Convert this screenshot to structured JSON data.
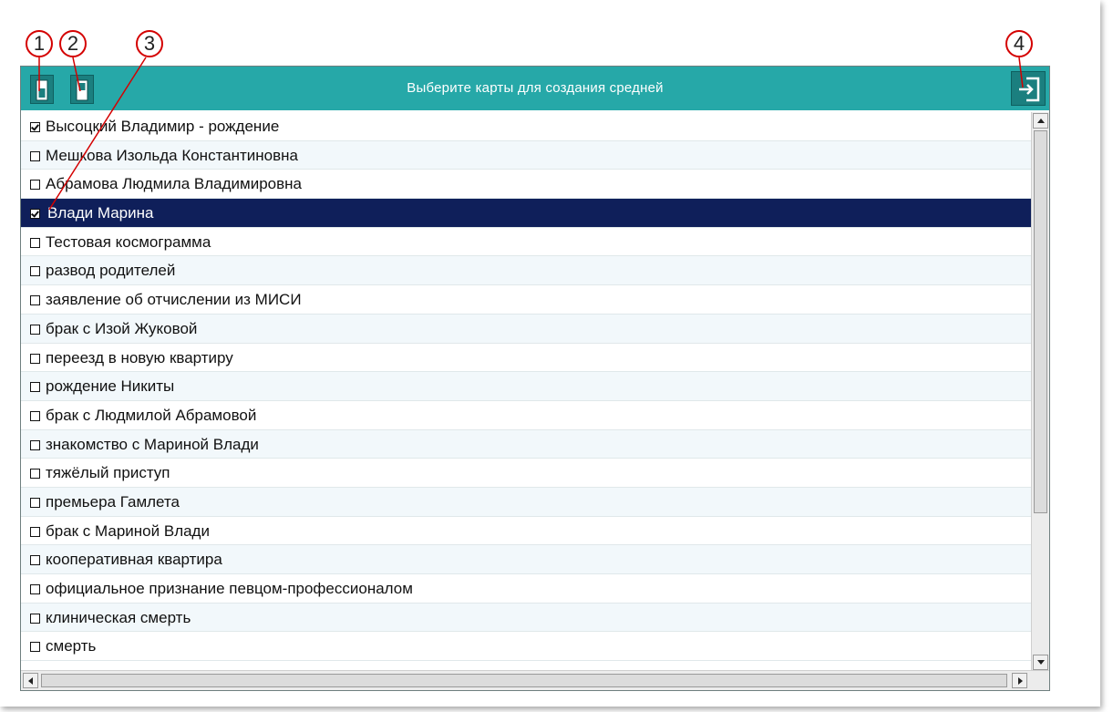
{
  "header": {
    "title": "Выберите карты для создания средней"
  },
  "toolbar": {
    "left_button_1_icon": "select-all-icon",
    "left_button_2_icon": "deselect-all-icon",
    "exit_button_icon": "exit-icon"
  },
  "callouts": [
    "1",
    "2",
    "3",
    "4"
  ],
  "colors": {
    "titlebar": "#26a8a8",
    "selected_row": "#0f1f5a",
    "callout_border": "#d40000"
  },
  "list": {
    "items": [
      {
        "label": "Высоцкий Владимир - рождение",
        "checked": true,
        "selected": false
      },
      {
        "label": "Мешкова Изольда Константиновна",
        "checked": false,
        "selected": false
      },
      {
        "label": "Абрамова Людмила Владимировна",
        "checked": false,
        "selected": false
      },
      {
        "label": "Влади Марина",
        "checked": true,
        "selected": true
      },
      {
        "label": "Тестовая космограмма",
        "checked": false,
        "selected": false
      },
      {
        "label": "развод родителей",
        "checked": false,
        "selected": false
      },
      {
        "label": "заявление об отчислении из МИСИ",
        "checked": false,
        "selected": false
      },
      {
        "label": "брак с Изой Жуковой",
        "checked": false,
        "selected": false
      },
      {
        "label": "переезд в новую квартиру",
        "checked": false,
        "selected": false
      },
      {
        "label": "рождение Никиты",
        "checked": false,
        "selected": false
      },
      {
        "label": "брак с Людмилой Абрамовой",
        "checked": false,
        "selected": false
      },
      {
        "label": "знакомство с Мариной Влади",
        "checked": false,
        "selected": false
      },
      {
        "label": "тяжёлый приступ",
        "checked": false,
        "selected": false
      },
      {
        "label": "премьера Гамлета",
        "checked": false,
        "selected": false
      },
      {
        "label": "брак с Мариной Влади",
        "checked": false,
        "selected": false
      },
      {
        "label": "кооперативная квартира",
        "checked": false,
        "selected": false
      },
      {
        "label": "официальное признание певцом-профессионалом",
        "checked": false,
        "selected": false
      },
      {
        "label": "клиническая смерть",
        "checked": false,
        "selected": false
      },
      {
        "label": "смерть",
        "checked": false,
        "selected": false
      }
    ]
  }
}
